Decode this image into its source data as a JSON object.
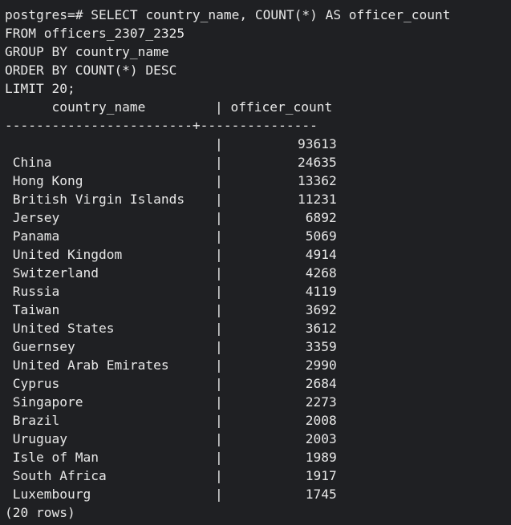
{
  "terminal": {
    "command_lines": [
      "postgres=# SELECT country_name, COUNT(*) AS officer_count",
      "FROM officers_2307_2325",
      "GROUP BY country_name",
      "ORDER BY COUNT(*) DESC",
      "LIMIT 20;"
    ],
    "header": {
      "col1": "      country_name      ",
      "sep": "|",
      "col2": " officer_count"
    },
    "divider": "------------------------+---------------",
    "rows": [
      {
        "country": "",
        "count": "93613"
      },
      {
        "country": " China",
        "count": "24635"
      },
      {
        "country": " Hong Kong",
        "count": "13362"
      },
      {
        "country": " British Virgin Islands",
        "count": "11231"
      },
      {
        "country": " Jersey",
        "count": "6892"
      },
      {
        "country": " Panama",
        "count": "5069"
      },
      {
        "country": " United Kingdom",
        "count": "4914"
      },
      {
        "country": " Switzerland",
        "count": "4268"
      },
      {
        "country": " Russia",
        "count": "4119"
      },
      {
        "country": " Taiwan",
        "count": "3692"
      },
      {
        "country": " United States",
        "count": "3612"
      },
      {
        "country": " Guernsey",
        "count": "3359"
      },
      {
        "country": " United Arab Emirates",
        "count": "2990"
      },
      {
        "country": " Cyprus",
        "count": "2684"
      },
      {
        "country": " Singapore",
        "count": "2273"
      },
      {
        "country": " Brazil",
        "count": "2008"
      },
      {
        "country": " Uruguay",
        "count": "2003"
      },
      {
        "country": " Isle of Man",
        "count": "1989"
      },
      {
        "country": " South Africa",
        "count": "1917"
      },
      {
        "country": " Luxembourg",
        "count": "1745"
      }
    ],
    "row_separator": "|",
    "footer": "(20 rows)"
  }
}
